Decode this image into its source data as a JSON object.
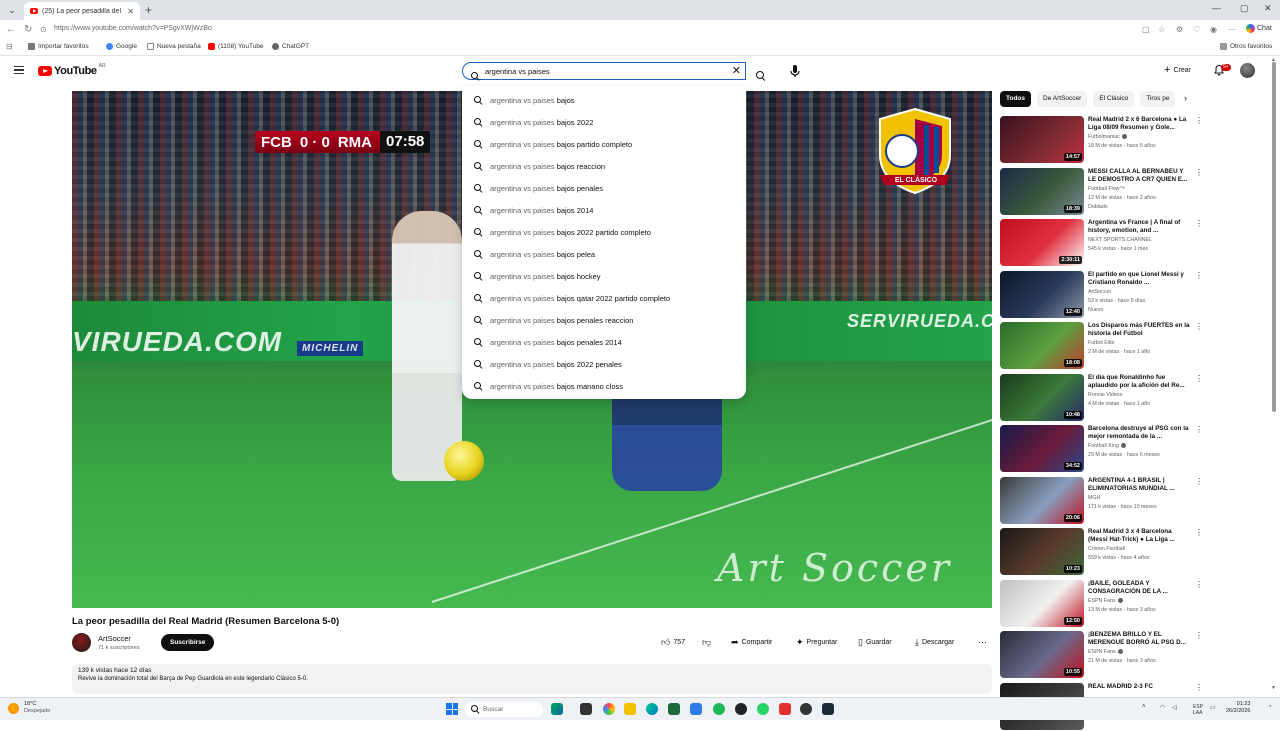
{
  "browser": {
    "tab_title": "(25) La peor pesadilla del Real Ma...",
    "url": "https://www.youtube.com/watch?v=PSgvXWjWzBo",
    "chat_label": "Chat",
    "bookmarks": [
      "Importar favoritos",
      "Google",
      "Nueva pestaña",
      "(1108) YouTube",
      "ChatGPT"
    ],
    "other_bookmarks": "Otros favoritos"
  },
  "header": {
    "logo_text": "YouTube",
    "country": "AR",
    "search_value": "argentina vs paises",
    "create_label": "Crear",
    "notification_count": "9+"
  },
  "suggestions": {
    "typed": "argentina vs paises",
    "items": [
      " bajos",
      " bajos 2022",
      " bajos partido completo",
      " bajos reaccion",
      " bajos penales",
      " bajos 2014",
      " bajos 2022 partido completo",
      " bajos pelea",
      " bajos hockey",
      " bajos qatar 2022 partido completo",
      " bajos penales reaccion",
      " bajos penales 2014",
      " bajos 2022 penales",
      " bajos manano closs"
    ]
  },
  "player": {
    "scoreboard": {
      "home": "FCB",
      "score": "0 · 0",
      "away": "RMA",
      "time": "07:58"
    },
    "board_left": "VIRUEDA.COM",
    "board_mid": "MICHELIN",
    "board_right": "SERVIRUEDA.COM",
    "crest_text": "EL CLÁSICO",
    "watermark": "Art Soccer"
  },
  "video": {
    "title": "La peor pesadilla del Real Madrid (Resumen Barcelona 5-0)",
    "channel": "ArtSoccer",
    "subscribers": "71 k suscriptores",
    "subscribe_label": "Suscribirse",
    "likes": "757",
    "share_label": "Compartir",
    "ask_label": "Preguntar",
    "save_label": "Guardar",
    "download_label": "Descargar",
    "views_date": "139 k vistas  hace 12 días",
    "description": "Revive la dominación total del Barça de Pep Guardiola en este legendario Clásico 5-0."
  },
  "chips": [
    "Todos",
    "De ArtSoccer",
    "El Clásico",
    "Tiros pe"
  ],
  "recommendations": [
    {
      "title": "Real Madrid 2 x 6 Barcelona ● La Liga 08/09 Resumen y Gole...",
      "channel": "Futbolmaniac",
      "meta": "18 M de vistas · hace 5 años",
      "extra": "",
      "duration": "14:57",
      "verified": true,
      "thumb": [
        "#3a1020",
        "#7a2a30",
        "#c03040"
      ]
    },
    {
      "title": "MESSI CALLA AL BERNABEU Y LE DEMOSTRO A CR7 QUIEN E...",
      "channel": "Football Flow™",
      "meta": "12 M de vistas · hace 2 años",
      "extra": "Doblado",
      "duration": "18:39",
      "verified": false,
      "thumb": [
        "#1a2a4a",
        "#3a5a3a",
        "#7a8a9a"
      ]
    },
    {
      "title": "Argentina vs France | A final of history, emotion, and ...",
      "channel": "NEXT SPORTS CHANNEL",
      "meta": "545 k vistas · hace 1 mes",
      "extra": "",
      "duration": "2:30:11",
      "verified": false,
      "thumb": [
        "#c01020",
        "#e03040",
        "#ffffff"
      ]
    },
    {
      "title": "El partido en que Lionel Messi y Cristiano Ronaldo ...",
      "channel": "ArtSoccer",
      "meta": "53 k vistas · hace 5 días",
      "extra": "Nuevo",
      "duration": "12:40",
      "verified": false,
      "thumb": [
        "#0a1a2a",
        "#2a3a5a",
        "#8a9aaa"
      ]
    },
    {
      "title": "Los Disparos más FUERTES en la historia del Fútbol",
      "channel": "Futbol Elite",
      "meta": "2 M de vistas · hace 1 año",
      "extra": "",
      "duration": "18:08",
      "verified": false,
      "thumb": [
        "#2a6a2a",
        "#5aa040",
        "#c04030"
      ]
    },
    {
      "title": "El día que Ronaldinho fue aplaudido por la afición del Re...",
      "channel": "Ronnie Videos",
      "meta": "4 M de vistas · hace 1 año",
      "extra": "",
      "duration": "10:48",
      "verified": false,
      "thumb": [
        "#1a3a1a",
        "#3a7a3a",
        "#2a2a6a"
      ]
    },
    {
      "title": "Barcelona destruye al PSG con la mejor remontada de la ...",
      "channel": "Football King",
      "meta": "29 M de vistas · hace 6 meses",
      "extra": "",
      "duration": "34:52",
      "verified": true,
      "thumb": [
        "#1a1a4a",
        "#6a1a3a",
        "#2a4a8a"
      ]
    },
    {
      "title": "ARGENTINA 4-1 BRASIL | ELIMINATORIAS MUNDIAL ...",
      "channel": "MGH",
      "meta": "171 k vistas · hace 10 meses",
      "extra": "",
      "duration": "20:06",
      "verified": false,
      "thumb": [
        "#3a3a3a",
        "#8aa0c0",
        "#c01020"
      ]
    },
    {
      "title": "Real Madrid 3 x 4 Barcelona (Messi Hat-Trick) ● La Liga ...",
      "channel": "Criston Football",
      "meta": "559 k vistas · hace 4 años",
      "extra": "",
      "duration": "10:23",
      "verified": false,
      "thumb": [
        "#1a1a1a",
        "#5a3a2a",
        "#3a6a3a"
      ]
    },
    {
      "title": "¡BAILE, GOLEADA Y CONSAGRACIÓN DE LA ...",
      "channel": "ESPN Fans",
      "meta": "13 M de vistas · hace 3 años",
      "extra": "",
      "duration": "12:50",
      "verified": true,
      "thumb": [
        "#c0c0c0",
        "#f0f0f0",
        "#c01020"
      ]
    },
    {
      "title": "¡BENZEMA BRILLÓ Y EL MERENGUE BORRÓ AL PSG D...",
      "channel": "ESPN Fans",
      "meta": "21 M de vistas · hace 3 años",
      "extra": "",
      "duration": "10:55",
      "verified": true,
      "thumb": [
        "#2a2a3a",
        "#6a6a8a",
        "#c01020"
      ]
    },
    {
      "title": "REAL MADRID 2-3 FC",
      "channel": "",
      "meta": "",
      "extra": "",
      "duration": "",
      "verified": false,
      "thumb": [
        "#1a1a1a",
        "#3a3a3a",
        "#5a5a5a"
      ]
    }
  ],
  "taskbar": {
    "temperature": "18°C",
    "weather": "Despejado",
    "search_placeholder": "Buscar",
    "lang": "ESP",
    "lang2": "LAA",
    "time": "01:23",
    "date": "26/2/2026"
  },
  "colors": {
    "accent": "#ff0000",
    "search_border": "#1c62b9",
    "subscribe_bg": "#0f0f0f"
  }
}
